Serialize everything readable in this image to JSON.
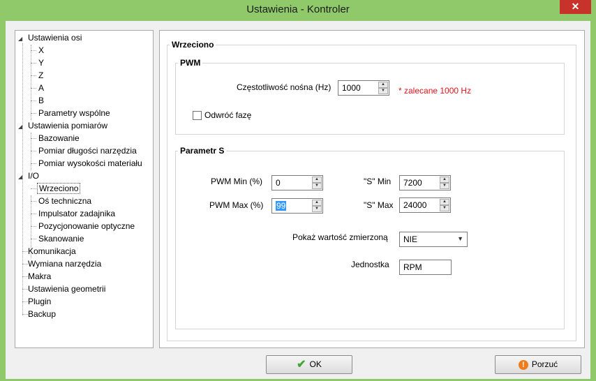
{
  "window": {
    "title": "Ustawienia - Kontroler",
    "close_glyph": "✕"
  },
  "tree": [
    {
      "label": "Ustawienia osi",
      "expanded": true,
      "children": [
        "X",
        "Y",
        "Z",
        "A",
        "B",
        "Parametry wspólne"
      ]
    },
    {
      "label": "Ustawienia pomiarów",
      "expanded": true,
      "children": [
        "Bazowanie",
        "Pomiar długości narzędzia",
        "Pomiar wysokości materiału"
      ]
    },
    {
      "label": "I/O",
      "expanded": true,
      "children": [
        "Wrzeciono",
        "Oś techniczna",
        "Impulsator zadajnika",
        "Pozycjonowanie optyczne",
        "Skanowanie"
      ]
    },
    {
      "label": "Komunikacja"
    },
    {
      "label": "Wymiana narzędzia"
    },
    {
      "label": "Makra"
    },
    {
      "label": "Ustawienia geometrii"
    },
    {
      "label": "Plugin"
    },
    {
      "label": "Backup"
    }
  ],
  "selected_item": "Wrzeciono",
  "panel": {
    "title": "Wrzeciono",
    "pwm": {
      "title": "PWM",
      "carrier_label": "Częstotliwość nośna (Hz)",
      "carrier_value": "1000",
      "carrier_hint": "* zalecane 1000 Hz",
      "invert_label": "Odwróć fazę",
      "invert_checked": false
    },
    "params": {
      "title": "Parametr S",
      "pwm_min_label": "PWM Min (%)",
      "pwm_min_value": "0",
      "pwm_max_label": "PWM Max (%)",
      "pwm_max_value": "99",
      "s_min_label": "\"S\" Min",
      "s_min_value": "7200",
      "s_max_label": "\"S\" Max",
      "s_max_value": "24000",
      "show_measured_label": "Pokaż wartość zmierzoną",
      "show_measured_value": "NIE",
      "unit_label": "Jednostka",
      "unit_value": "RPM"
    }
  },
  "buttons": {
    "ok": "OK",
    "cancel": "Porzuć"
  },
  "colors": {
    "frame": "#8fc96a",
    "hint": "#e3141a",
    "selection": "#3399ff",
    "close": "#c7332b"
  },
  "icons": {
    "ok": "check-icon",
    "cancel": "warning-icon",
    "expand": "triangle-down-icon"
  }
}
